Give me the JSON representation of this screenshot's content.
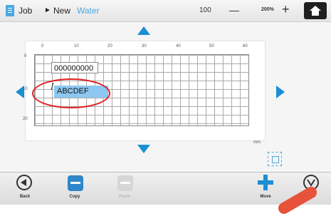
{
  "header": {
    "crumb_job": "Job",
    "crumb_sep": "►",
    "crumb_new": "New",
    "crumb_current": "Water",
    "zoom_value": "100",
    "zoom_out": "—",
    "zoom_preset": "200%",
    "zoom_in": "+"
  },
  "ruler": {
    "top_ticks": [
      "0",
      "10",
      "20",
      "30",
      "40",
      "50",
      "60"
    ],
    "left_ticks": [
      "0",
      "10",
      "20"
    ],
    "unit": "mm"
  },
  "editor": {
    "field1_text": "000000000",
    "field2_text": "ABCDEF"
  },
  "toolbar": {
    "back_label": "Back",
    "copy_label": "Copy",
    "paste_label": "Paste",
    "move_label": "Move",
    "ok_label": "Ok"
  },
  "colors": {
    "accent": "#4aa8e0",
    "annotation": "#e02020",
    "selection": "#8dc8f2"
  }
}
